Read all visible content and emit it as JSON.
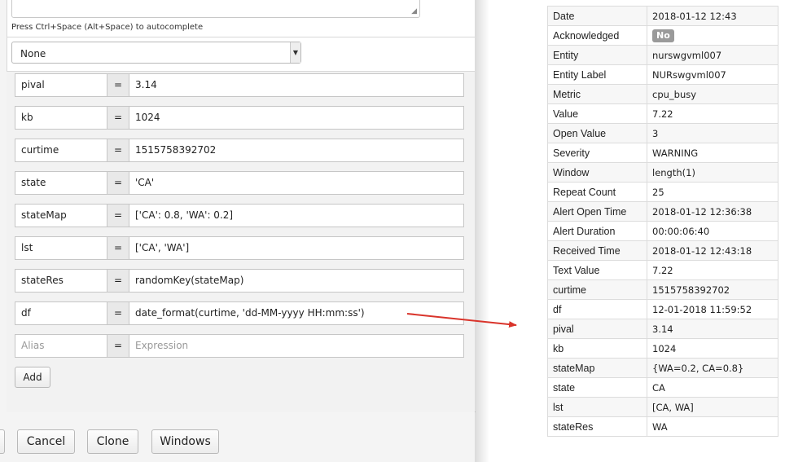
{
  "editor": {
    "hint": "Press Ctrl+Space (Alt+Space) to autocomplete",
    "select_value": "None",
    "eq_sign": "=",
    "rows": [
      {
        "alias": "pival",
        "expr": "3.14"
      },
      {
        "alias": "kb",
        "expr": "1024"
      },
      {
        "alias": "curtime",
        "expr": "1515758392702"
      },
      {
        "alias": "state",
        "expr": "'CA'"
      },
      {
        "alias": "stateMap",
        "expr": "['CA': 0.8, 'WA': 0.2]"
      },
      {
        "alias": "lst",
        "expr": "['CA', 'WA']"
      },
      {
        "alias": "stateRes",
        "expr": "randomKey(stateMap)"
      },
      {
        "alias": "df",
        "expr": "date_format(curtime, 'dd-MM-yyyy HH:mm:ss')"
      }
    ],
    "new_row": {
      "alias_placeholder": "Alias",
      "expr_placeholder": "Expression"
    },
    "add_label": "Add"
  },
  "footer": {
    "cancel_label": "Cancel",
    "clone_label": "Clone",
    "windows_label": "Windows"
  },
  "details": [
    {
      "key": "Date",
      "value": "2018-01-12 12:43"
    },
    {
      "key": "Acknowledged",
      "value": "No",
      "badge": true
    },
    {
      "key": "Entity",
      "value": "nurswgvml007"
    },
    {
      "key": "Entity Label",
      "value": "NURswgvml007"
    },
    {
      "key": "Metric",
      "value": "cpu_busy"
    },
    {
      "key": "Value",
      "value": "7.22"
    },
    {
      "key": "Open Value",
      "value": "3"
    },
    {
      "key": "Severity",
      "value": "WARNING"
    },
    {
      "key": "Window",
      "value": "length(1)"
    },
    {
      "key": "Repeat Count",
      "value": "25"
    },
    {
      "key": "Alert Open Time",
      "value": "2018-01-12 12:36:38"
    },
    {
      "key": "Alert Duration",
      "value": "00:00:06:40"
    },
    {
      "key": "Received Time",
      "value": "2018-01-12 12:43:18"
    },
    {
      "key": "Text Value",
      "value": "7.22"
    },
    {
      "key": "curtime",
      "value": "1515758392702"
    },
    {
      "key": "df",
      "value": "12-01-2018 11:59:52"
    },
    {
      "key": "pival",
      "value": "3.14"
    },
    {
      "key": "kb",
      "value": "1024"
    },
    {
      "key": "stateMap",
      "value": "{WA=0.2, CA=0.8}"
    },
    {
      "key": "state",
      "value": "CA"
    },
    {
      "key": "lst",
      "value": "[CA, WA]"
    },
    {
      "key": "stateRes",
      "value": "WA"
    }
  ],
  "colors": {
    "arrow": "#d9342b",
    "badge": "#9a9a9a"
  },
  "icons": {
    "select_arrow": "chevron-down-icon",
    "resize_grip": "resize-grip-icon"
  }
}
